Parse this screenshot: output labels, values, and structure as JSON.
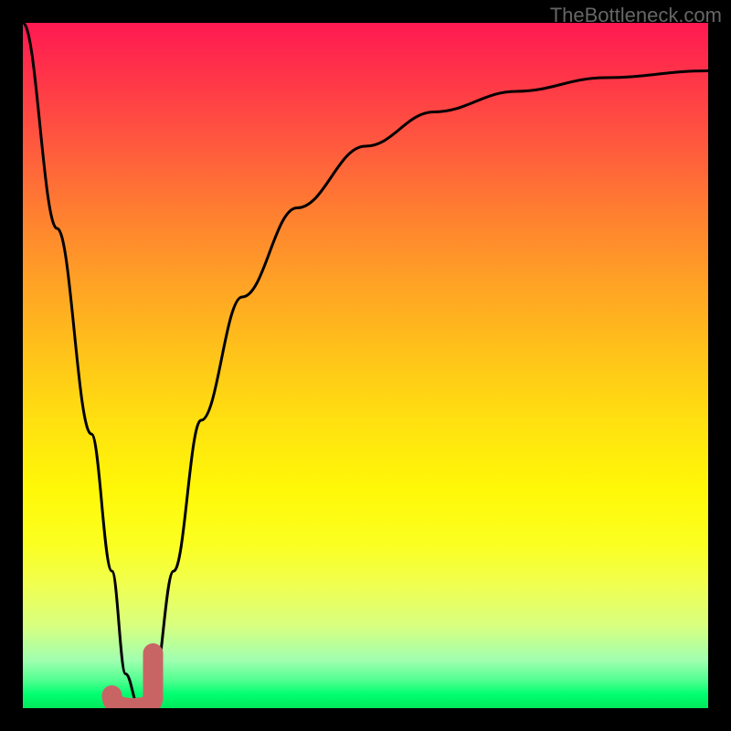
{
  "watermark": "TheBottleneck.com",
  "chart_data": {
    "type": "line",
    "title": "",
    "xlabel": "",
    "ylabel": "",
    "xlim": [
      0,
      100
    ],
    "ylim": [
      0,
      100
    ],
    "gradient_meaning": "background red-to-green indicates bottleneck severity (red=bad, green=good)",
    "series": [
      {
        "name": "bottleneck-curve",
        "x": [
          0,
          5,
          10,
          13,
          15,
          17,
          19,
          22,
          26,
          32,
          40,
          50,
          60,
          72,
          85,
          100
        ],
        "y": [
          100,
          70,
          40,
          20,
          5,
          0,
          3,
          20,
          42,
          60,
          73,
          82,
          87,
          90,
          92,
          93
        ]
      }
    ],
    "marker": {
      "name": "sweet-spot-j-marker",
      "x_range": [
        13,
        19
      ],
      "y_range": [
        0,
        8
      ],
      "shape": "J",
      "color": "#c96464"
    }
  }
}
